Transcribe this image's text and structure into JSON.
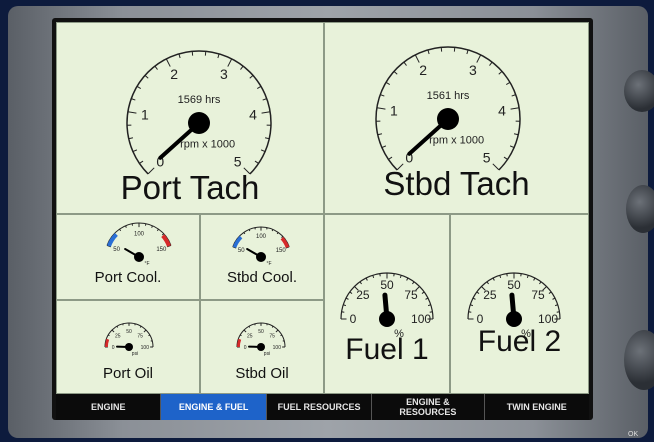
{
  "gauges": {
    "port_tach": {
      "title": "Port Tach",
      "hours": "1569 hrs",
      "unit": "rpm x 1000",
      "ticks": [
        "0",
        "1",
        "2",
        "3",
        "4",
        "5"
      ],
      "value": 0.5
    },
    "stbd_tach": {
      "title": "Stbd Tach",
      "hours": "1561 hrs",
      "unit": "rpm x 1000",
      "ticks": [
        "0",
        "1",
        "2",
        "3",
        "4",
        "5"
      ],
      "value": 0.5
    },
    "port_cool": {
      "title": "Port Cool.",
      "ticks": [
        "50",
        "100",
        "150"
      ],
      "unit": "°F"
    },
    "stbd_cool": {
      "title": "Stbd Cool.",
      "ticks": [
        "50",
        "100",
        "150"
      ],
      "unit": "°F"
    },
    "port_oil": {
      "title": "Port Oil",
      "ticks": [
        "0",
        "25",
        "50",
        "75",
        "100"
      ],
      "unit": "psi"
    },
    "stbd_oil": {
      "title": "Stbd Oil",
      "ticks": [
        "0",
        "25",
        "50",
        "75",
        "100"
      ],
      "unit": "psi"
    },
    "fuel1": {
      "title": "Fuel 1",
      "ticks": [
        "0",
        "25",
        "50",
        "75",
        "100"
      ],
      "unit": "%"
    },
    "fuel2": {
      "title": "Fuel 2",
      "ticks": [
        "0",
        "25",
        "50",
        "75",
        "100"
      ],
      "unit": "%"
    }
  },
  "tabs": [
    {
      "label": "ENGINE",
      "active": false
    },
    {
      "label": "ENGINE & FUEL",
      "active": true
    },
    {
      "label": "FUEL RESOURCES",
      "active": false
    },
    {
      "label": "ENGINE & RESOURCES",
      "active": false
    },
    {
      "label": "TWIN ENGINE",
      "active": false
    }
  ],
  "ok_label": "OK",
  "colors": {
    "background": "#e8f2da",
    "needle": "#000000",
    "cold": "#2a6fd6",
    "hot": "#d62a2a",
    "active_tab": "#1e63c9"
  }
}
